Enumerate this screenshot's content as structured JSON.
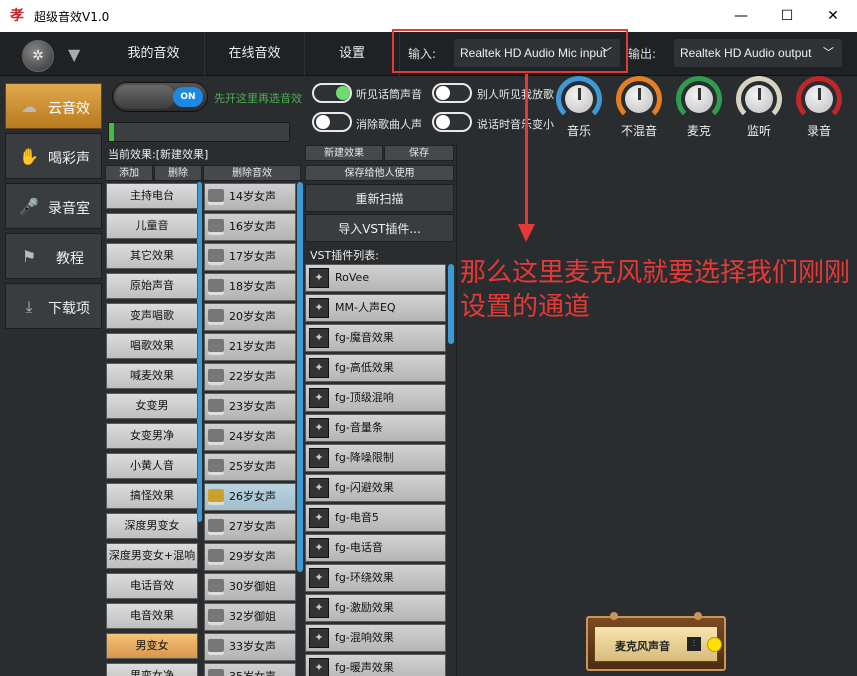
{
  "window": {
    "title": "超级音效V1.0",
    "logo_glyph": "孝",
    "min": "—",
    "max": "☐",
    "close": "✕"
  },
  "topnav": {
    "skin_icon": "✲",
    "menu_icon": "▼",
    "tabs": [
      "我的音效",
      "在线音效",
      "设置"
    ],
    "input_label": "输入:",
    "input_device": "Realtek HD Audio Mic input",
    "output_label": "输出:",
    "output_device": "Realtek HD Audio output",
    "chevron": "﹀"
  },
  "sidebar": {
    "items": [
      {
        "label": "云音效",
        "icon": "☁",
        "active": true
      },
      {
        "label": "喝彩声",
        "icon": "✋",
        "active": false
      },
      {
        "label": "录音室",
        "icon": "🎤",
        "active": false
      },
      {
        "label": "教程",
        "icon": "⚑",
        "active": false
      },
      {
        "label": "下载项",
        "icon": "⤓",
        "active": false
      }
    ]
  },
  "controls": {
    "main_toggle_on": "ON",
    "hint": "先开这里再选音效",
    "meter_level": 0.03,
    "toggles": [
      {
        "label": "听见话筒声音",
        "on": true
      },
      {
        "label": "消除歌曲人声",
        "on": false
      },
      {
        "label": "别人听见我放歌",
        "on": false
      },
      {
        "label": "说话时音乐变小",
        "on": false
      }
    ]
  },
  "dials": [
    {
      "label": "音乐",
      "color": "#3e9ad6"
    },
    {
      "label": "不混音",
      "color": "#e67e22"
    },
    {
      "label": "麦克",
      "color": "#2e9d4f"
    },
    {
      "label": "监听",
      "color": "#d8d2c0"
    },
    {
      "label": "录音",
      "color": "#c0262a"
    }
  ],
  "effects": {
    "current": "当前效果:[新建效果]",
    "btn_add": "添加",
    "btn_delete": "删除",
    "btn_delete_sound": "删除音效",
    "btn_new": "新建效果",
    "btn_save": "保存",
    "btn_save_share": "保存给他人使用",
    "btn_rescan": "重新扫描",
    "btn_import_vst": "导入VST插件...",
    "vst_list_label": "VST插件列表:",
    "categories": [
      "主持电台",
      "儿童音",
      "其它效果",
      "原始声音",
      "变声唱歌",
      "唱歌效果",
      "喊麦效果",
      "女变男",
      "女变男净",
      "小黄人音",
      "搞怪效果",
      "深度男变女",
      "深度男变女+混响",
      "电话音效",
      "电音效果",
      "男变女",
      "男变女净"
    ],
    "selected_category": 15,
    "presets": [
      "14岁女声",
      "16岁女声",
      "17岁女声",
      "18岁女声",
      "20岁女声",
      "21岁女声",
      "22岁女声",
      "23岁女声",
      "24岁女声",
      "25岁女声",
      "26岁女声",
      "27岁女声",
      "29岁女声",
      "30岁御姐",
      "32岁御姐",
      "33岁女声",
      "35岁女声"
    ],
    "selected_preset": 10,
    "vst_plugins": [
      "RoVee",
      "MM-人声EQ",
      "fg-魔音效果",
      "fg-高低效果",
      "fg-顶级混响",
      "fg-音量条",
      "fg-降噪限制",
      "fg-闪避效果",
      "fg-电音5",
      "fg-电话音",
      "fg-环绕效果",
      "fg-激励效果",
      "fg-混响效果",
      "fg-暖声效果"
    ]
  },
  "annotation": "那么这里麦克风就要选择我们刚刚设置的通道",
  "mic_widget": {
    "label": "麦克风声音",
    "mixer_icon": "⫶"
  }
}
